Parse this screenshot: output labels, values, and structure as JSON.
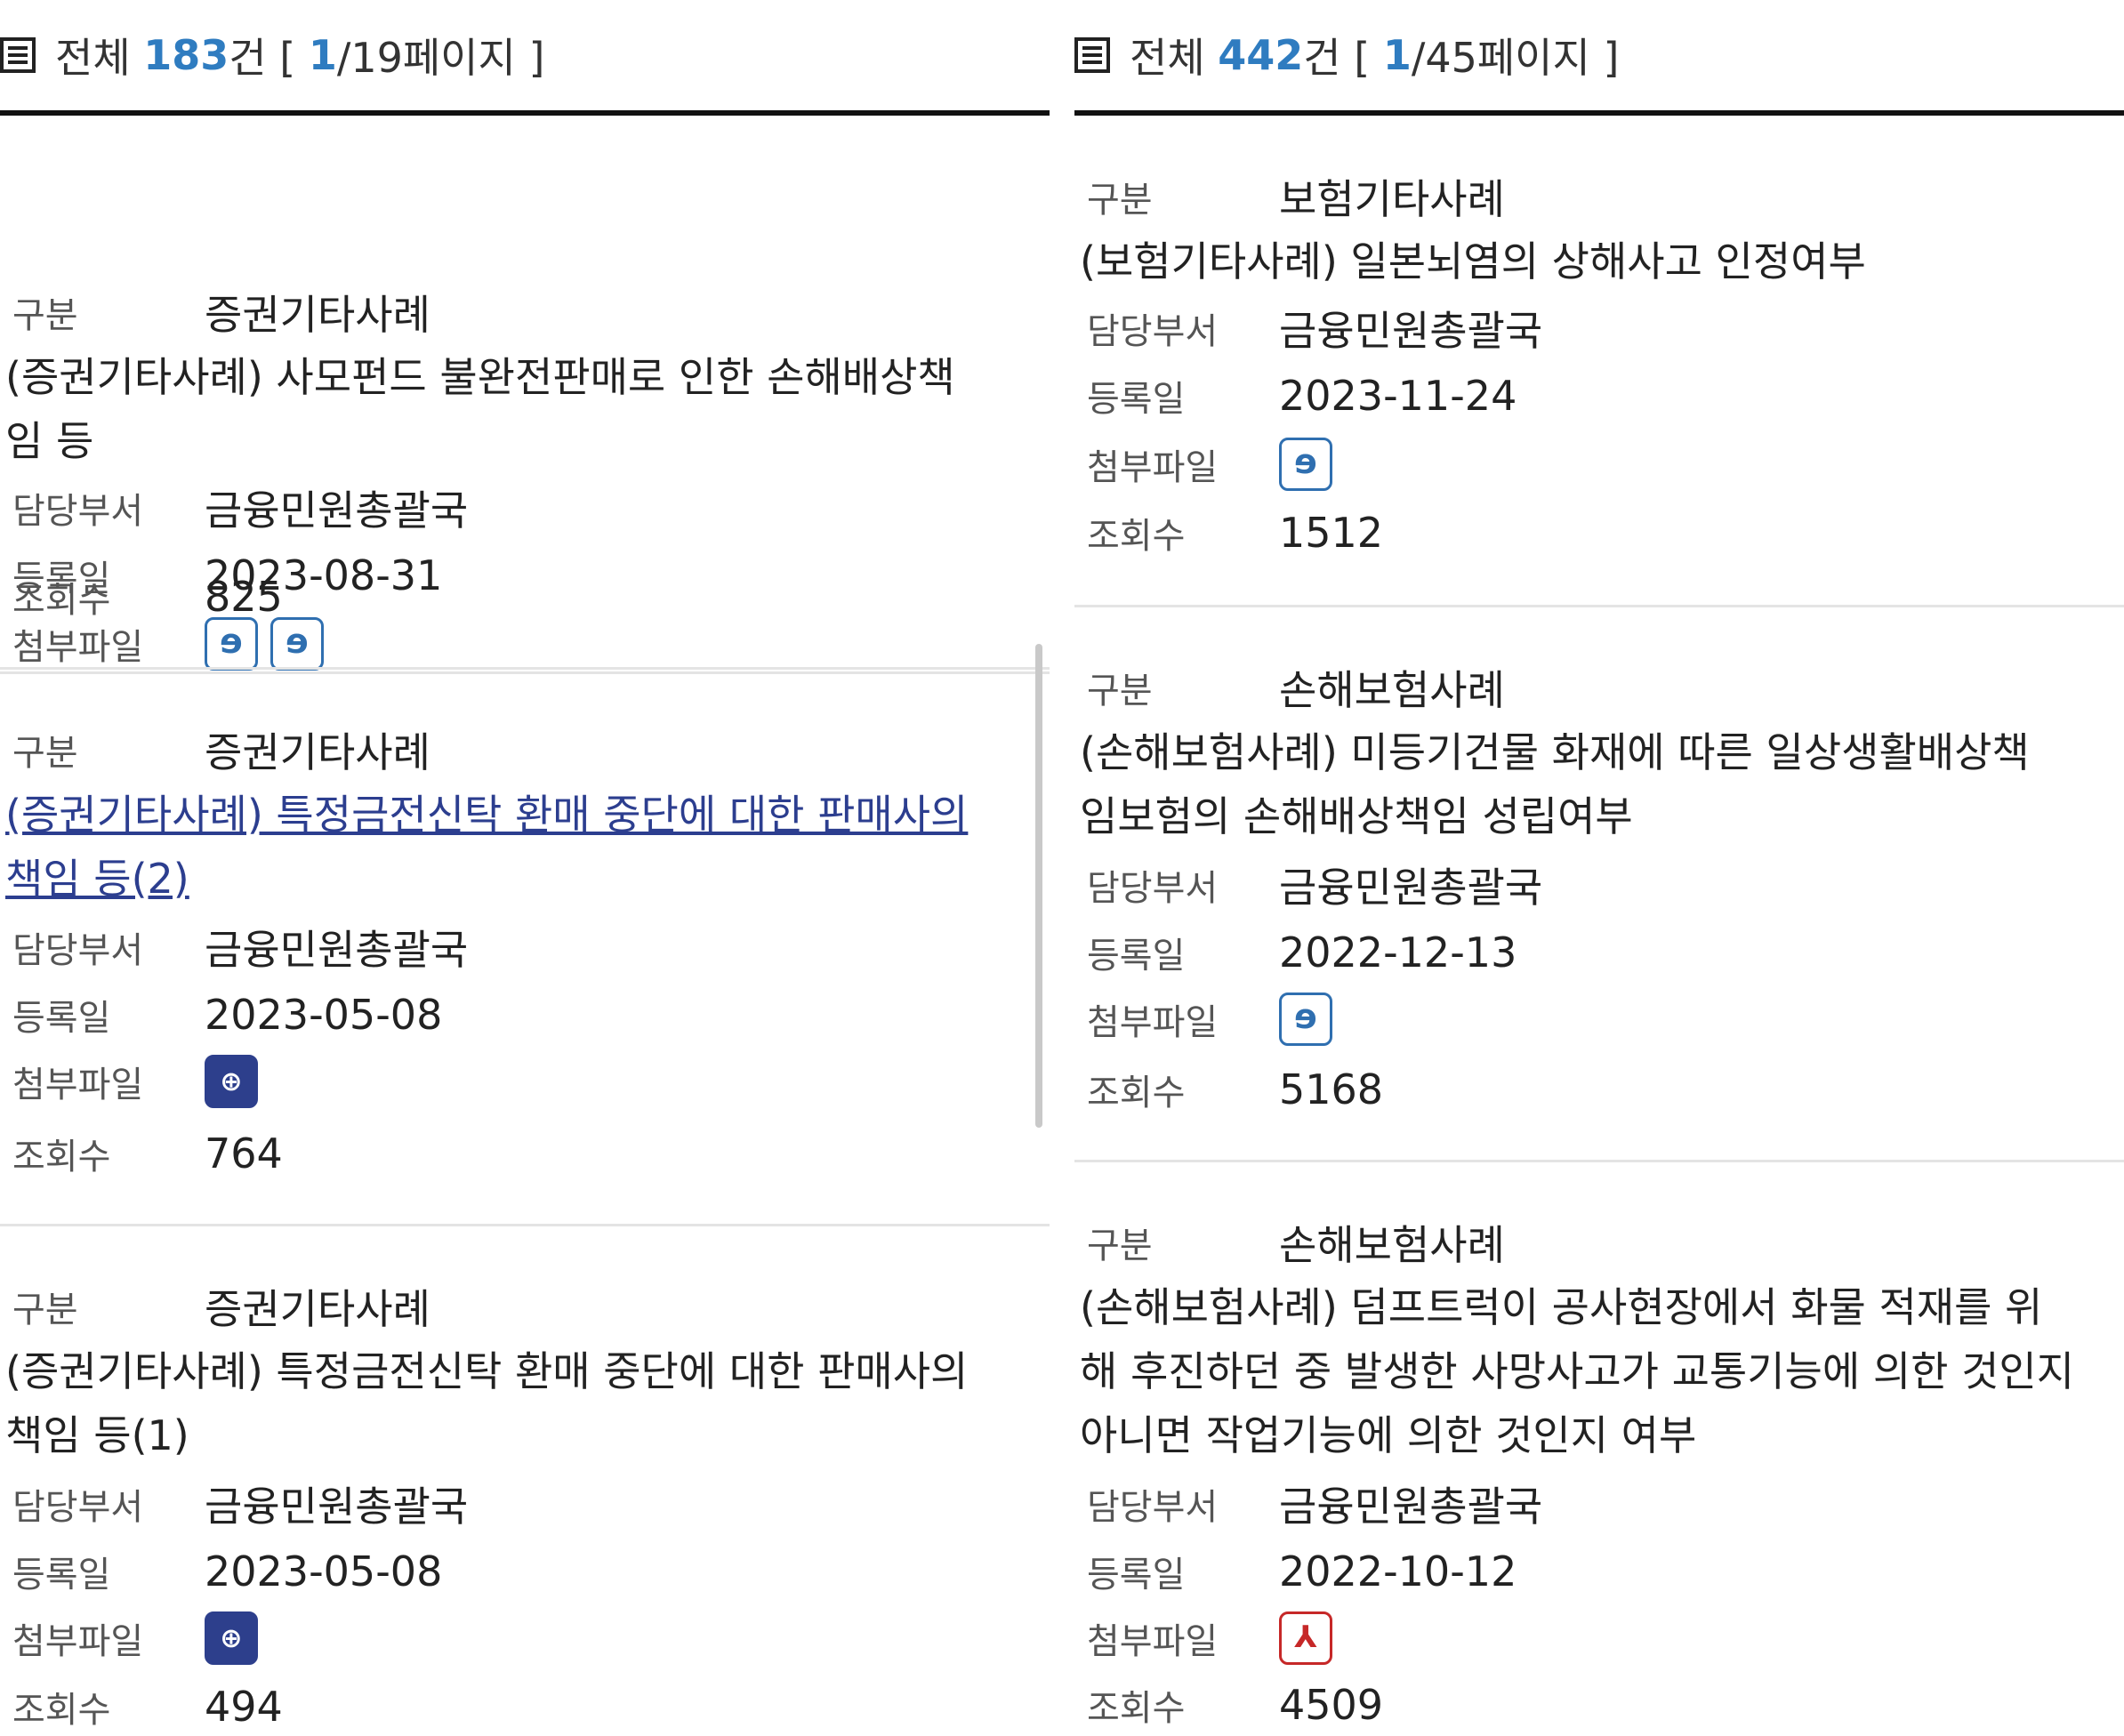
{
  "left": {
    "header": {
      "prefix": "전체 ",
      "total": "183",
      "mid": "건 [ ",
      "page": "1",
      "suffix": "/19페이지 ]"
    },
    "items": [
      {
        "category_label": "구분",
        "category": "증권기타사례",
        "title_lines": [
          "(증권기타사례) 사모펀드 불완전판매로 인한 손해배상책",
          "임 등"
        ],
        "dept_label": "담당부서",
        "dept": "금융민원총괄국",
        "date_label": "등록일",
        "date": "2023-08-31",
        "file_label": "첨부파일",
        "files": [
          "hwp-icon",
          "hwp-icon"
        ],
        "views_label": "조회수",
        "views": "825"
      },
      {
        "category_label": "구분",
        "category": "증권기타사례",
        "title_lines": [
          "(증권기타사례) 특정금전신탁 환매 중단에 대한 판매사의",
          "책임 등(2)"
        ],
        "dept_label": "담당부서",
        "dept": "금융민원총괄국",
        "date_label": "등록일",
        "date": "2023-05-08",
        "file_label": "첨부파일",
        "files": [
          "link-icon"
        ],
        "views_label": "조회수",
        "views": "764"
      },
      {
        "category_label": "구분",
        "category": "증권기타사례",
        "title_lines": [
          "(증권기타사례) 특정금전신탁 환매 중단에 대한 판매사의",
          "책임 등(1)"
        ],
        "dept_label": "담당부서",
        "dept": "금융민원총괄국",
        "date_label": "등록일",
        "date": "2023-05-08",
        "file_label": "첨부파일",
        "files": [
          "link-icon"
        ],
        "views_label": "조회수",
        "views": "494"
      }
    ]
  },
  "right": {
    "header": {
      "prefix": "전체 ",
      "total": "442",
      "mid": "건 [ ",
      "page": "1",
      "suffix": "/45페이지 ]"
    },
    "items": [
      {
        "category_label": "구분",
        "category": "보험기타사례",
        "title_lines": [
          "(보험기타사례) 일본뇌염의 상해사고 인정여부"
        ],
        "dept_label": "담당부서",
        "dept": "금융민원총괄국",
        "date_label": "등록일",
        "date": "2023-11-24",
        "file_label": "첨부파일",
        "files": [
          "hwp-icon"
        ],
        "views_label": "조회수",
        "views": "1512"
      },
      {
        "category_label": "구분",
        "category": "손해보험사례",
        "title_lines": [
          "(손해보험사례) 미등기건물 화재에 따른 일상생활배상책",
          "임보험의 손해배상책임 성립여부"
        ],
        "dept_label": "담당부서",
        "dept": "금융민원총괄국",
        "date_label": "등록일",
        "date": "2022-12-13",
        "file_label": "첨부파일",
        "files": [
          "hwp-icon"
        ],
        "views_label": "조회수",
        "views": "5168"
      },
      {
        "category_label": "구분",
        "category": "손해보험사례",
        "title_lines": [
          "(손해보험사례) 덤프트럭이 공사현장에서 화물 적재를 위",
          "해 후진하던 중 발생한 사망사고가 교통기능에 의한 것인지",
          "아니면 작업기능에 의한 것인지 여부"
        ],
        "dept_label": "담당부서",
        "dept": "금융민원총괄국",
        "date_label": "등록일",
        "date": "2022-10-12",
        "file_label": "첨부파일",
        "files": [
          "pdf-icon"
        ],
        "views_label": "조회수",
        "views": "4509"
      }
    ]
  }
}
